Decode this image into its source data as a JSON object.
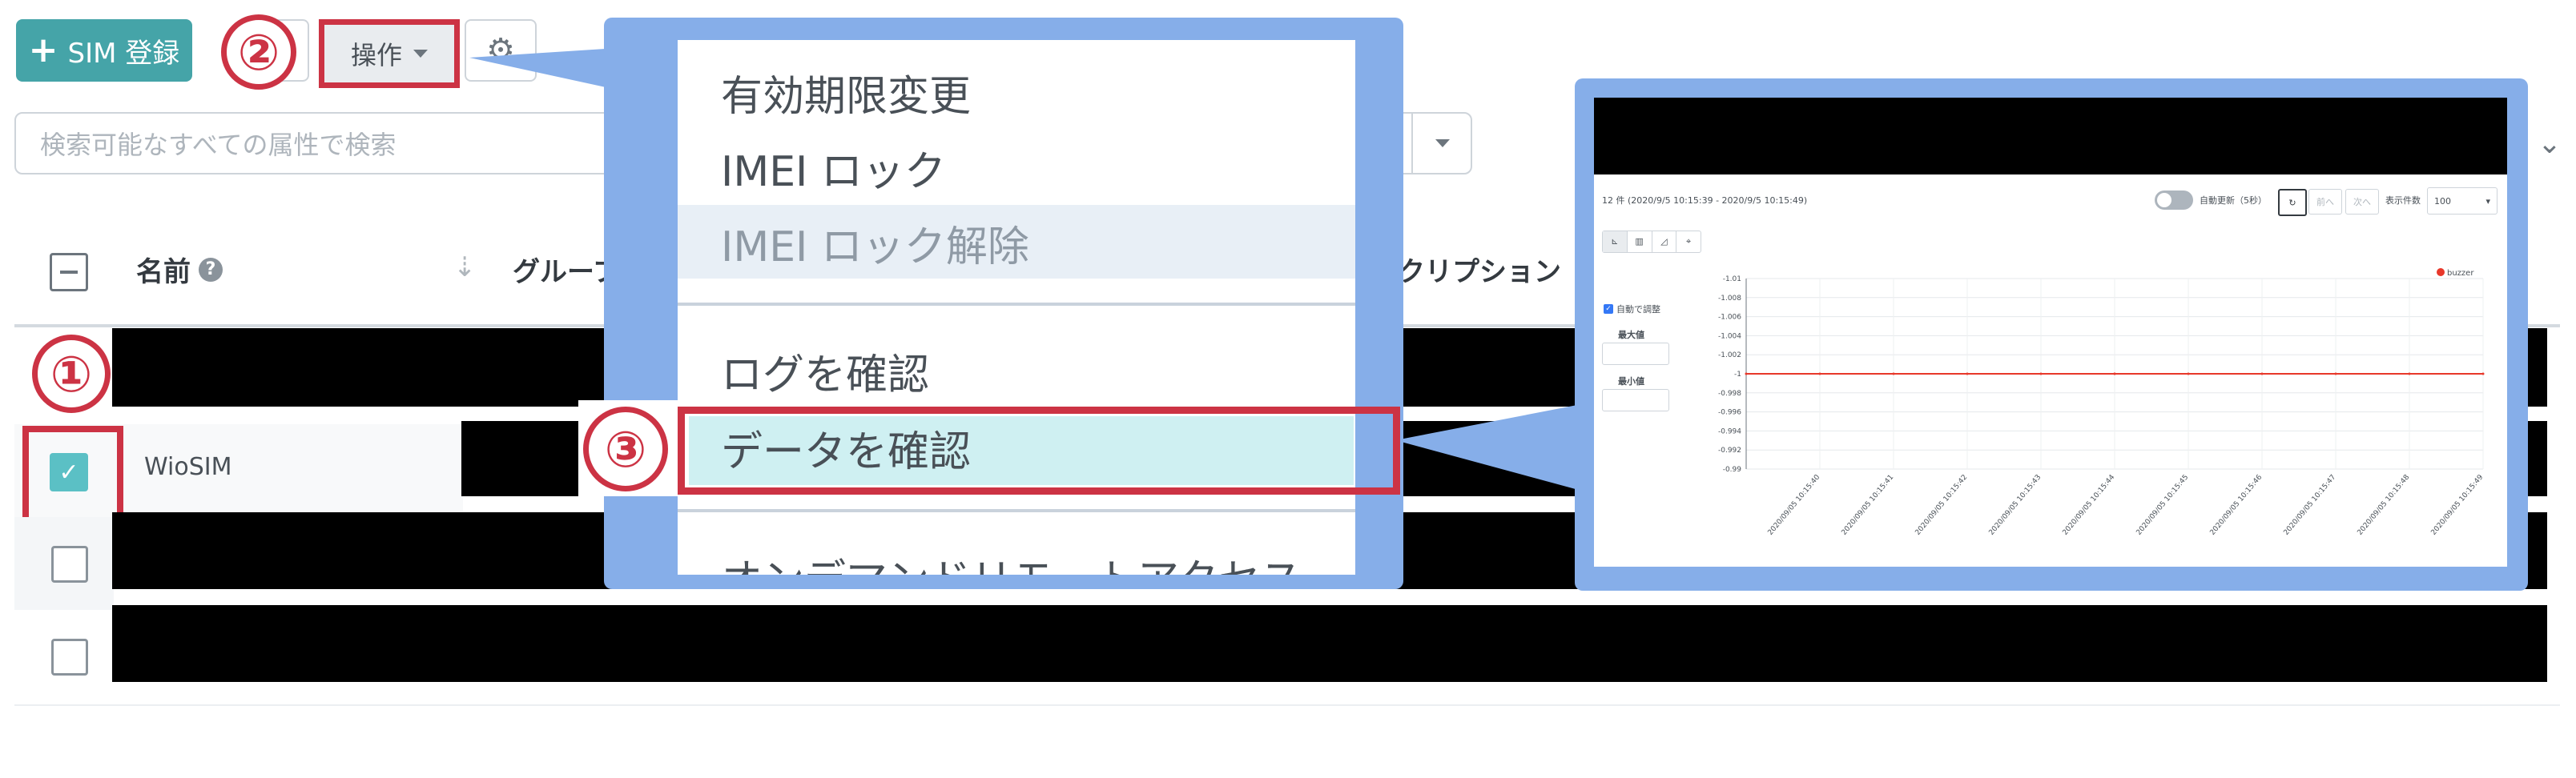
{
  "toolbar": {
    "sim_register_label": "SIM 登録",
    "operations_label": "操作",
    "settings_icon": "gear-icon"
  },
  "markers": {
    "one": "①",
    "two": "②",
    "three": "③"
  },
  "search": {
    "placeholder": "検索可能なすべての属性で検索"
  },
  "table": {
    "columns": {
      "name": "名前",
      "group": "グループ",
      "subscription": "クリプション"
    },
    "selected_row_name": "WioSIM"
  },
  "menu": {
    "items": [
      {
        "label": "有効期限変更"
      },
      {
        "label": "IMEI ロック"
      },
      {
        "label": "IMEI ロック解除"
      },
      {
        "label": "ログを確認"
      },
      {
        "label": "データを確認"
      },
      {
        "label": "オンデマンドリモートアクセス"
      }
    ]
  },
  "preview": {
    "range_text": "12 件 (2020/9/5 10:15:39 - 2020/9/5 10:15:49)",
    "auto_refresh_label": "自動更新（5秒）",
    "prev_label": "前へ",
    "next_label": "次へ",
    "page_size_label": "表示件数",
    "page_size_value": "100",
    "auto_adjust_label": "自動で調整",
    "max_label": "最大値",
    "min_label": "最小値"
  },
  "colors": {
    "accent_red": "#cc3344",
    "teal": "#45a4a8",
    "callout_blue": "#86aee9",
    "series_red": "#e8382a"
  },
  "chart_data": {
    "type": "line",
    "legend": "buzzer",
    "ylim": [
      -1.01,
      -0.99
    ],
    "y_ticks": [
      "-1.01",
      "-1.008",
      "-1.006",
      "-1.004",
      "-1.002",
      "-1",
      "-0.998",
      "-0.996",
      "-0.994",
      "-0.992",
      "-0.99"
    ],
    "x_ticks": [
      "2020/09/05 10:15:40",
      "2020/09/05 10:15:41",
      "2020/09/05 10:15:42",
      "2020/09/05 10:15:43",
      "2020/09/05 10:15:44",
      "2020/09/05 10:15:45",
      "2020/09/05 10:15:46",
      "2020/09/05 10:15:47",
      "2020/09/05 10:15:48",
      "2020/09/05 10:15:49"
    ],
    "series": [
      {
        "name": "buzzer",
        "x": [
          "2020/09/05 10:15:39",
          "2020/09/05 10:15:40",
          "2020/09/05 10:15:41",
          "2020/09/05 10:15:42",
          "2020/09/05 10:15:43",
          "2020/09/05 10:15:44",
          "2020/09/05 10:15:44",
          "2020/09/05 10:15:45",
          "2020/09/05 10:15:46",
          "2020/09/05 10:15:47",
          "2020/09/05 10:15:48",
          "2020/09/05 10:15:49"
        ],
        "values": [
          -1,
          -1,
          -1,
          -1,
          -1,
          -1,
          -1,
          -1,
          -1,
          -1,
          -1,
          -1
        ]
      }
    ]
  }
}
